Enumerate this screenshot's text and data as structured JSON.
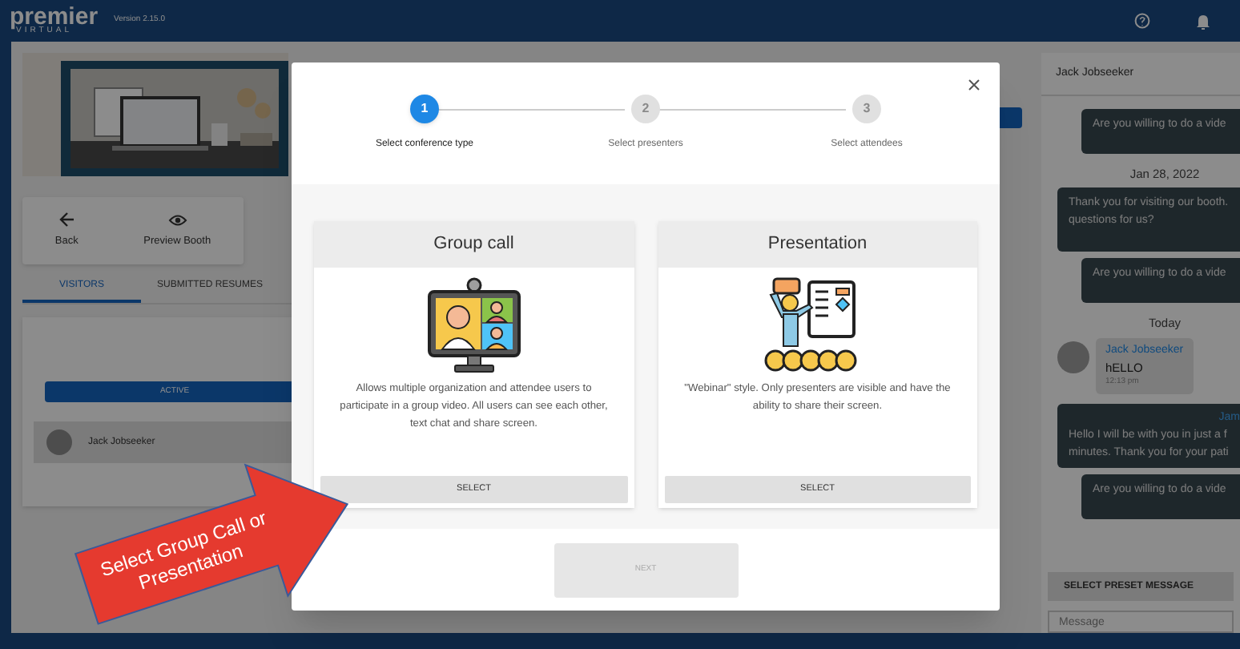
{
  "header": {
    "logo": "premier",
    "logo_sub": "VIRTUAL",
    "version": "Version 2.15.0"
  },
  "booth": {
    "actions": [
      {
        "kind": "back",
        "label": "Back"
      },
      {
        "kind": "preview",
        "label": "Preview Booth"
      }
    ],
    "tabs": [
      {
        "label": "VISITORS",
        "selected": true
      },
      {
        "label": "SUBMITTED RESUMES",
        "selected": false
      }
    ],
    "filter": "ACTIVE",
    "visitors": [
      {
        "name": "Jack Jobseeker"
      }
    ]
  },
  "chat": {
    "title": "Jack Jobseeker",
    "messages": [
      {
        "kind": "outgoing",
        "lines": [
          "Are you willing to do a vide"
        ]
      },
      {
        "kind": "date",
        "text": "Jan 28, 2022"
      },
      {
        "kind": "outgoing",
        "lines": [
          "Thank you for visiting our booth.",
          "questions for us?"
        ]
      },
      {
        "kind": "outgoing",
        "lines": [
          "Are you willing to do a vide"
        ]
      },
      {
        "kind": "date",
        "text": "Today"
      },
      {
        "kind": "incoming",
        "sender": "Jack Jobseeker",
        "lines": [
          "hELLO"
        ],
        "time": "12:13 pm"
      },
      {
        "kind": "outgoing",
        "sender": "Jam",
        "lines": [
          "Hello I will be with you in just a f",
          "minutes. Thank you for your pati"
        ]
      },
      {
        "kind": "outgoing",
        "lines": [
          "Are you willing to do a vide"
        ]
      }
    ],
    "preset_button": "SELECT PRESET MESSAGE",
    "input": {
      "placeholder": "Message"
    }
  },
  "modal": {
    "steps": [
      {
        "number": "1",
        "label": "Select conference type",
        "selected": true
      },
      {
        "number": "2",
        "label": "Select presenters",
        "selected": false
      },
      {
        "number": "3",
        "label": "Select attendees",
        "selected": false
      }
    ],
    "options": [
      {
        "kind": "group",
        "title": "Group call",
        "description": "Allows multiple organization and attendee users to participate in a group video. All users can see each other, text chat and share screen.",
        "button": "SELECT"
      },
      {
        "kind": "presentation",
        "title": "Presentation",
        "description": "\"Webinar\" style. Only presenters are visible and have the ability to share their screen.",
        "button": "SELECT"
      }
    ],
    "next": {
      "label": "NEXT",
      "disabled": true
    }
  },
  "callout": {
    "text": "Select Group Call or Presentation"
  }
}
